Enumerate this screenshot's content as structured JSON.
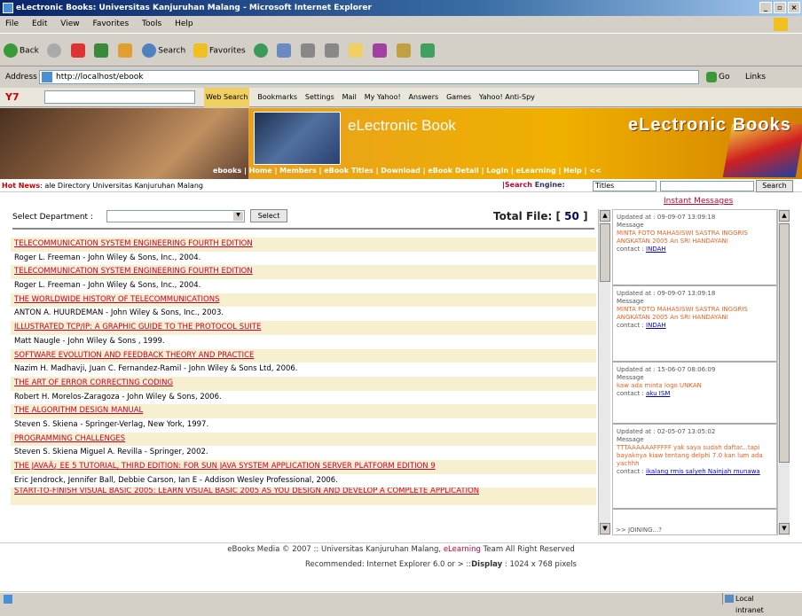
{
  "window": {
    "title": "eLectronic Books: Universitas Kanjuruhan Malang - Microsoft Internet Explorer"
  },
  "menu": [
    "File",
    "Edit",
    "View",
    "Favorites",
    "Tools",
    "Help"
  ],
  "toolbar": {
    "back": "Back",
    "search": "Search",
    "favorites": "Favorites"
  },
  "address": {
    "label": "Address",
    "url": "http://localhost/ebook",
    "go": "Go",
    "links": "Links"
  },
  "yahoo": {
    "logo": "Y7",
    "web_search": "Web Search",
    "bookmarks": "Bookmarks",
    "settings": "Settings",
    "mail": "Mail",
    "my_yahoo": "My Yahoo!",
    "answers": "Answers",
    "games": "Games",
    "antispy": "Yahoo! Anti-Spy"
  },
  "banner": {
    "title": "eLectronic Book",
    "logo": "eLectronic Books",
    "nav": "ebooks | Home | Members | eBook Titles | Download | eBook Detail | Login | eLearning | Help | <<"
  },
  "hotnews": {
    "label": "Hot News",
    "text": "ale Directory Universitas Kanjuruhan Malang"
  },
  "search": {
    "label_a": "Search",
    "label_b": "Engine",
    "select": "Titles",
    "button": "Search"
  },
  "instant": "Instant Messages",
  "department": {
    "label": "Select Department :",
    "button": "Select"
  },
  "total": {
    "label": "Total File: [",
    "count": "50",
    "end": "]"
  },
  "books": [
    {
      "title": "TELECOMMUNICATION SYSTEM ENGINEERING FOURTH EDITION",
      "author": "Roger L. Freeman - John Wiley & Sons, Inc., 2004."
    },
    {
      "title": "TELECOMMUNICATION SYSTEM ENGINEERING FOURTH EDITION",
      "author": "Roger L. Freeman - John Wiley & Sons, Inc., 2004."
    },
    {
      "title": "THE WORLDWIDE HISTORY OF TELECOMMUNICATIONS",
      "author": "ANTON A. HUURDEMAN - John Wiley & Sons, Inc., 2003."
    },
    {
      "title": "ILLUSTRATED TCP/IP: A GRAPHIC GUIDE TO THE PROTOCOL SUITE",
      "author": "Matt Naugle - John Wiley & Sons , 1999."
    },
    {
      "title": "SOFTWARE EVOLUTION AND FEEDBACK THEORY AND PRACTICE",
      "author": "Nazim H. Madhavji, Juan C. Fernandez-Ramil - John Wiley & Sons Ltd, 2006."
    },
    {
      "title": "THE ART OF ERROR CORRECTING CODING",
      "author": "Robert H. Morelos-Zaragoza - John Wiley & Sons, 2006."
    },
    {
      "title": "THE ALGORITHM DESIGN MANUAL",
      "author": "Steven S. Skiena - Springer-Verlag, New York, 1997."
    },
    {
      "title": "PROGRAMMING CHALLENGES",
      "author": "Steven S. Skiena Miguel A. Revilla - Springer, 2002."
    },
    {
      "title": "THE JAVAÂ¿ EE 5 TUTORIAL, THIRD EDITION: FOR SUN JAVA SYSTEM APPLICATION SERVER PLATFORM EDITION 9",
      "author": "Eric Jendrock, Jennifer Ball, Debbie Carson, Ian E - Addison Wesley Professional, 2006."
    },
    {
      "title": "START-TO-FINISH VISUAL BASIC 2005: LEARN VISUAL BASIC 2005 AS YOU DESIGN AND DEVELOP A COMPLETE APPLICATION",
      "author": ""
    }
  ],
  "messages": [
    {
      "updated_label": "Updated at",
      "updated": ": 09-09-07 13:09:18",
      "msg_label": "Message",
      "text": "MINTA FOTO MAHASISWI SASTRA INGGRIS ANGKATAN 2005 An SRI HANDAYANI",
      "contact_label": "contact",
      "contact": "INDAH"
    },
    {
      "updated_label": "Updated at",
      "updated": ": 09-09-07 13:09:18",
      "msg_label": "Message",
      "text": "MINTA FOTO MAHASISWI SASTRA INGGRIS ANGKATAN 2005 An SRI HANDAYANI",
      "contact_label": "contact",
      "contact": "INDAH"
    },
    {
      "updated_label": "Updated at",
      "updated": ": 15-06-07 08:06:09",
      "msg_label": "Message",
      "text": "kaw ada minta logo UNKAN",
      "contact_label": "contact",
      "contact": "aku ISM"
    },
    {
      "updated_label": "Updated at",
      "updated": ": 02-05-07 13:05:02",
      "msg_label": "Message",
      "text": "TTTAAAAAAFFFFF yak saya sudah daftar...tapi bayaknya kiaw tentang delphi 7.0 kan lum ada yachhh",
      "contact_label": "contact",
      "contact": "ikalang rmis salyeh Nainjah munawa"
    }
  ],
  "joining": ">> JOINING...?",
  "footer": {
    "line1_a": "eBooks Media © 2007 :: Universitas Kanjuruhan Malang,",
    "line1_el": "eLearning",
    "line1_b": "Team All Right Reserved",
    "line2_a": "Recommended: Internet Explorer 6.0 or > ::",
    "line2_b": "Display",
    "line2_c": ": 1024 x 768 pixels"
  },
  "status": {
    "zone": "Local intranet"
  }
}
